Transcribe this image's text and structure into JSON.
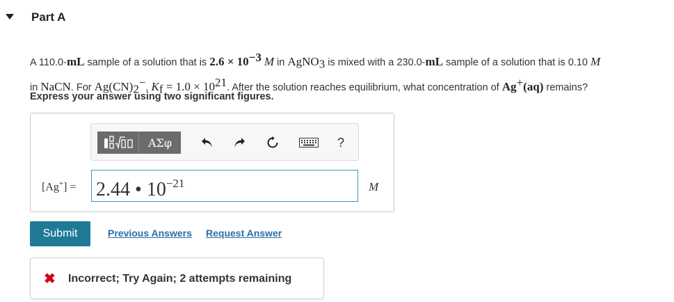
{
  "part": {
    "title": "Part A"
  },
  "question": {
    "t1": "A 110.0-",
    "mL": "mL",
    "t2": " sample of a solution that is ",
    "conc1": "2.6 × 10",
    "conc1_exp": "−3",
    "M": "M",
    "t3": " in ",
    "agno3": "AgNO",
    "agno3_sub": "3",
    "t4": " is mixed with a 230.0-",
    "t5": " sample of a solution that is 0.10 ",
    "line2_t1": "in ",
    "nacn": "NaCN",
    "line2_t2": ". For ",
    "complex": "Ag(CN)",
    "complex_sub": "2",
    "complex_sup": "−",
    "line2_t3": ", ",
    "kf": "K",
    "kf_sub": "f",
    "kf_val": " = 1.0 × 10",
    "kf_exp": "21",
    "line2_t4": ". After the solution reaches equilibrium, what concentration of ",
    "ag": "Ag",
    "ag_sup": "+",
    "aq": "(aq)",
    "line2_t5": " remains?"
  },
  "instruction": "Express your answer using two significant figures.",
  "toolbar": {
    "templates_icon": "sqrt-template-icon",
    "greek_label": "ΑΣφ",
    "undo_icon": "undo-icon",
    "redo_icon": "redo-icon",
    "reset_icon": "reset-icon",
    "keyboard_icon": "keyboard-icon",
    "help_label": "?"
  },
  "answer": {
    "label_prefix": "[Ag",
    "label_sup": "+",
    "label_suffix": "] =",
    "mantissa": "2.44",
    "dot": " • ",
    "base": "10",
    "exponent": "−21",
    "unit": "M"
  },
  "actions": {
    "submit_label": "Submit",
    "previous_answers_label": "Previous Answers",
    "request_answer_label": "Request Answer"
  },
  "feedback": {
    "icon": "✖",
    "message": "Incorrect; Try Again; 2 attempts remaining"
  },
  "colors": {
    "accent": "#1f7a96",
    "link": "#2a6ea8",
    "error": "#d0021b",
    "input_border": "#4a90c0"
  }
}
